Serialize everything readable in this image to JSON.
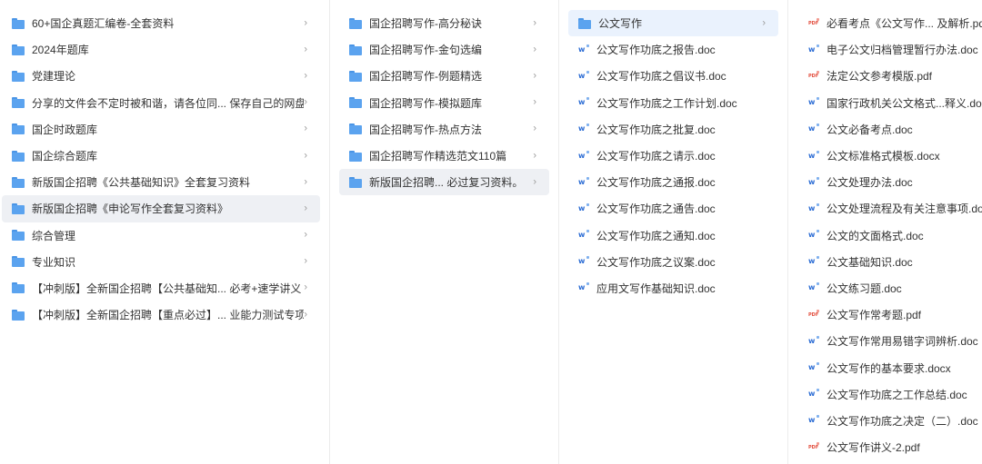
{
  "columns": {
    "col1": {
      "items": [
        {
          "label": "60+国企真题汇编卷-全套资料",
          "type": "folder"
        },
        {
          "label": "2024年题库",
          "type": "folder"
        },
        {
          "label": "党建理论",
          "type": "folder"
        },
        {
          "label": "分享的文件会不定时被和谐，请各位同... 保存自己的网盘",
          "type": "folder"
        },
        {
          "label": "国企时政题库",
          "type": "folder"
        },
        {
          "label": "国企综合题库",
          "type": "folder"
        },
        {
          "label": "新版国企招聘《公共基础知识》全套复习资料",
          "type": "folder"
        },
        {
          "label": "新版国企招聘《申论写作全套复习资料》",
          "type": "folder",
          "selected": true
        },
        {
          "label": "综合管理",
          "type": "folder"
        },
        {
          "label": "专业知识",
          "type": "folder"
        },
        {
          "label": "【冲刺版】全新国企招聘【公共基础知... 必考+速学讲义",
          "type": "folder"
        },
        {
          "label": "【冲刺版】全新国企招聘【重点必过】... 业能力测试专项",
          "type": "folder"
        }
      ]
    },
    "col2": {
      "items": [
        {
          "label": "国企招聘写作-高分秘诀",
          "type": "folder"
        },
        {
          "label": "国企招聘写作-金句选编",
          "type": "folder"
        },
        {
          "label": "国企招聘写作-例题精选",
          "type": "folder"
        },
        {
          "label": "国企招聘写作-模拟题库",
          "type": "folder"
        },
        {
          "label": "国企招聘写作-热点方法",
          "type": "folder"
        },
        {
          "label": "国企招聘写作精选范文110篇",
          "type": "folder"
        },
        {
          "label": "新版国企招聘... 必过复习资料。",
          "type": "folder",
          "selected": true
        }
      ]
    },
    "col3": {
      "items": [
        {
          "label": "公文写作",
          "type": "folder",
          "selected": true
        },
        {
          "label": "公文写作功底之报告.doc",
          "type": "word"
        },
        {
          "label": "公文写作功底之倡议书.doc",
          "type": "word"
        },
        {
          "label": "公文写作功底之工作计划.doc",
          "type": "word"
        },
        {
          "label": "公文写作功底之批复.doc",
          "type": "word"
        },
        {
          "label": "公文写作功底之请示.doc",
          "type": "word"
        },
        {
          "label": "公文写作功底之通报.doc",
          "type": "word"
        },
        {
          "label": "公文写作功底之通告.doc",
          "type": "word"
        },
        {
          "label": "公文写作功底之通知.doc",
          "type": "word"
        },
        {
          "label": "公文写作功底之议案.doc",
          "type": "word"
        },
        {
          "label": "应用文写作基础知识.doc",
          "type": "word"
        }
      ]
    },
    "col4": {
      "items": [
        {
          "label": "必看考点《公文写作... 及解析.pdf",
          "type": "pdf"
        },
        {
          "label": "电子公文归档管理暂行办法.doc",
          "type": "word"
        },
        {
          "label": "法定公文参考模版.pdf",
          "type": "pdf"
        },
        {
          "label": "国家行政机关公文格式...释义.docx",
          "type": "word"
        },
        {
          "label": "公文必备考点.doc",
          "type": "word"
        },
        {
          "label": "公文标准格式模板.docx",
          "type": "word"
        },
        {
          "label": "公文处理办法.doc",
          "type": "word"
        },
        {
          "label": "公文处理流程及有关注意事项.doc",
          "type": "word"
        },
        {
          "label": "公文的文面格式.doc",
          "type": "word"
        },
        {
          "label": "公文基础知识.doc",
          "type": "word"
        },
        {
          "label": "公文练习题.doc",
          "type": "word"
        },
        {
          "label": "公文写作常考题.pdf",
          "type": "pdf"
        },
        {
          "label": "公文写作常用易错字词辨析.doc",
          "type": "word"
        },
        {
          "label": "公文写作的基本要求.docx",
          "type": "word"
        },
        {
          "label": "公文写作功底之工作总结.doc",
          "type": "word"
        },
        {
          "label": "公文写作功底之决定（二）.doc",
          "type": "word"
        },
        {
          "label": "公文写作讲义-2.pdf",
          "type": "pdf"
        }
      ]
    }
  },
  "icons": {
    "folder": "folder-icon",
    "word": "word-doc-icon",
    "pdf": "pdf-file-icon",
    "chevron": "chevron-right-icon"
  },
  "glyphs": {
    "chevron": "›",
    "word": "w",
    "pdf": "PDF"
  },
  "colors": {
    "folder": "#5ba3ef",
    "word": "#2b6cd4",
    "pdf": "#e24b3b",
    "selected_gray": "#eef0f4",
    "selected_blue": "#eaf2fd"
  }
}
